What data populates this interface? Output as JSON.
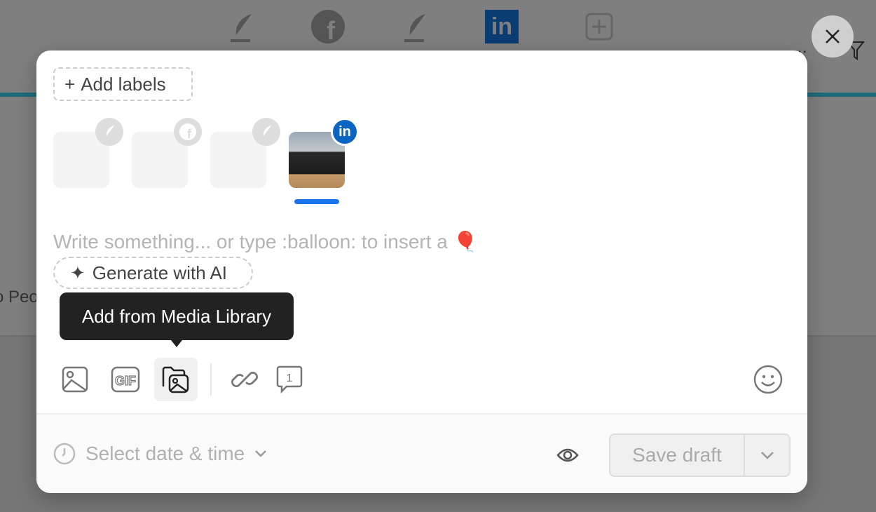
{
  "background": {
    "networks": [
      "feather-icon",
      "facebook-icon",
      "feather-icon",
      "linkedin-icon",
      "add-network-icon"
    ],
    "partial_text": "o Peo"
  },
  "modal": {
    "add_labels": "Add labels",
    "accounts": [
      {
        "network": "feather",
        "selected": false
      },
      {
        "network": "facebook",
        "selected": false
      },
      {
        "network": "feather",
        "selected": false
      },
      {
        "network": "linkedin",
        "selected": true
      }
    ],
    "editor_placeholder": "Write something... or type :balloon: to insert a 🎈",
    "generate_ai": "Generate with AI",
    "tooltip": "Add from Media Library",
    "comment_count": "1",
    "gif_label": "GIF",
    "footer": {
      "date_placeholder": "Select date & time",
      "save_label": "Save draft"
    }
  },
  "colors": {
    "accent": "#1a73e8",
    "linkedin": "#0a66c2",
    "tooltip": "#222222"
  }
}
